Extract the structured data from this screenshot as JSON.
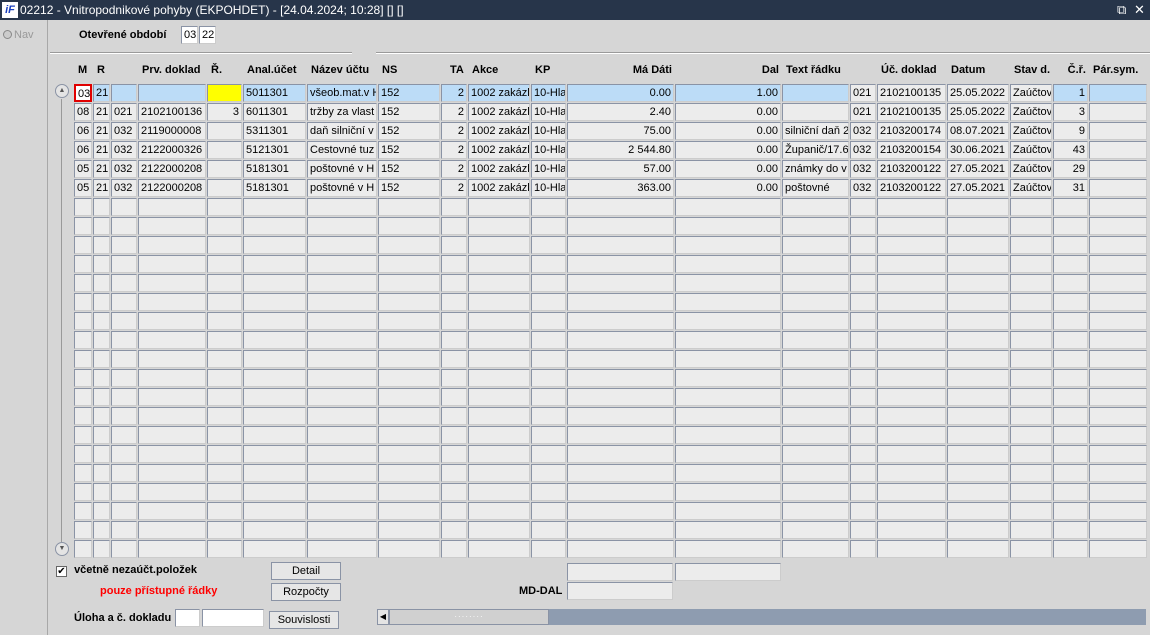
{
  "window": {
    "logo": "iF",
    "title": "02212 - Vnitropodnikové pohyby (EKPOHDET) - [24.04.2024; 10:28]  [] []",
    "restore_icon": "⧉",
    "close_icon": "✕"
  },
  "nav": {
    "label": "Nav"
  },
  "period": {
    "label": "Otevřené období",
    "month": "03",
    "year": "22"
  },
  "columns": [
    "M",
    "R",
    "",
    "Prv. doklad",
    "Ř.",
    "Anal.účet",
    "Název účtu",
    "NS",
    "TA",
    "Akce",
    "KP",
    "Má Dáti",
    "Dal",
    "Text řádku",
    "",
    "Úč. doklad",
    "Datum",
    "Stav d.",
    "Č.ř.",
    "Pár.sym."
  ],
  "rows": [
    [
      "03",
      "21",
      "",
      "",
      "",
      "5011301",
      "všeob.mat.v H",
      "152",
      "2",
      "1002 zakázl",
      "10-Hla",
      "0.00",
      "1.00",
      "",
      "021",
      "2102100135",
      "25.05.2022",
      "Zaúčtov",
      "1",
      ""
    ],
    [
      "08",
      "21",
      "021",
      "2102100136",
      "3",
      "6011301",
      "tržby za vlast",
      "152",
      "2",
      "1002 zakázl",
      "10-Hla",
      "2.40",
      "0.00",
      "",
      "021",
      "2102100135",
      "25.05.2022",
      "Zaúčtov",
      "3",
      ""
    ],
    [
      "06",
      "21",
      "032",
      "2119000008",
      "",
      "5311301",
      "daň silniční v",
      "152",
      "2",
      "1002 zakázl",
      "10-Hla",
      "75.00",
      "0.00",
      "silniční daň 2",
      "032",
      "2103200174",
      "08.07.2021",
      "Zaúčtov",
      "9",
      ""
    ],
    [
      "06",
      "21",
      "032",
      "2122000326",
      "",
      "5121301",
      "Cestovné tuz",
      "152",
      "2",
      "1002 zakázl",
      "10-Hla",
      "2 544.80",
      "0.00",
      "Županič/17.6",
      "032",
      "2103200154",
      "30.06.2021",
      "Zaúčtov",
      "43",
      ""
    ],
    [
      "05",
      "21",
      "032",
      "2122000208",
      "",
      "5181301",
      "poštovné v H",
      "152",
      "2",
      "1002 zakázl",
      "10-Hla",
      "57.00",
      "0.00",
      "známky do v",
      "032",
      "2103200122",
      "27.05.2021",
      "Zaúčtov",
      "29",
      ""
    ],
    [
      "05",
      "21",
      "032",
      "2122000208",
      "",
      "5181301",
      "poštovné v H",
      "152",
      "2",
      "1002 zakázl",
      "10-Hla",
      "363.00",
      "0.00",
      "poštovné",
      "032",
      "2103200122",
      "27.05.2021",
      "Zaúčtov",
      "31",
      ""
    ]
  ],
  "empty_rows": 19,
  "bottom": {
    "checkbox_label": "včetně nezaúčt.položek",
    "checkbox_checked": true,
    "red_note": "pouze přístupné řádky",
    "detail_button": "Detail",
    "budgets_button": "Rozpočty",
    "links_button": "Souvislosti",
    "task_label": "Úloha a č. dokladu",
    "mddal_label": "MD-DAL"
  },
  "colors": {
    "selected_row": "#bcdcf7",
    "highlight": "#ffff00",
    "note": "#ff0000",
    "titlebar": "#27354a"
  }
}
